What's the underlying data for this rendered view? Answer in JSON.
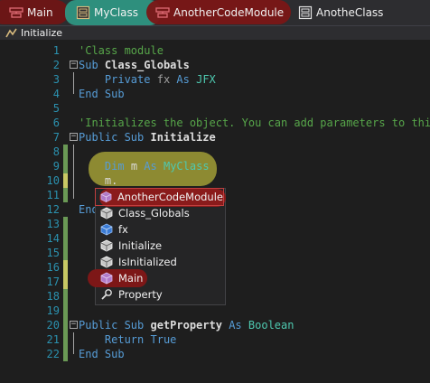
{
  "tabs": [
    {
      "label": "Main",
      "icon": "module-icon"
    },
    {
      "label": "MyClass",
      "icon": "class-module-icon"
    },
    {
      "label": "AnotherCodeModule",
      "icon": "module-icon"
    },
    {
      "label": "AnotheClass",
      "icon": "class-module-icon"
    }
  ],
  "breadcrumb": {
    "label": "Initialize",
    "icon": "method-icon"
  },
  "editor": {
    "line_numbers": [
      "1",
      "2",
      "3",
      "4",
      "5",
      "6",
      "7",
      "8",
      "9",
      "10",
      "11",
      "12",
      "13",
      "14",
      "15",
      "16",
      "17",
      "18",
      "19",
      "20",
      "21",
      "22"
    ],
    "lines": {
      "l1": {
        "comment": "'Class module"
      },
      "l2": {
        "kw": "Sub",
        "name": "Class_Globals"
      },
      "l3": {
        "kw": "Private",
        "var": "fx",
        "as": "As",
        "type": "JFX"
      },
      "l4": {
        "kw": "End Sub"
      },
      "l6": {
        "comment": "'Initializes the object. You can add parameters to this"
      },
      "l7": {
        "kw": "Public Sub",
        "name": "Initialize"
      },
      "l9": {
        "kw": "Dim",
        "var": "m",
        "as": "As",
        "type": "MyClass"
      },
      "l10": {
        "text": "m."
      },
      "l12": {
        "text": "End"
      },
      "l20": {
        "kw": "Public Sub",
        "name": "getProperty",
        "as": "As",
        "type": "Boolean"
      },
      "l21": {
        "kw": "Return",
        "value": "True"
      },
      "l22": {
        "kw": "End Sub"
      }
    }
  },
  "intellisense": {
    "items": [
      {
        "label": "AnotherCodeModule",
        "icon": "module-icon",
        "selected": true
      },
      {
        "label": "Class_Globals",
        "icon": "method-icon"
      },
      {
        "label": "fx",
        "icon": "field-icon"
      },
      {
        "label": "Initialize",
        "icon": "method-icon"
      },
      {
        "label": "IsInitialized",
        "icon": "method-icon"
      },
      {
        "label": "Main",
        "icon": "module-icon"
      },
      {
        "label": "Property",
        "icon": "property-icon"
      }
    ]
  },
  "colors": {
    "keyword": "#569cd6",
    "comment": "#57a64a",
    "type": "#4ec9b0",
    "line_number": "#2b91af",
    "highlight_red": "#8a1b1b",
    "highlight_green": "#2f9a86",
    "highlight_yellow": "#b9b43a"
  }
}
